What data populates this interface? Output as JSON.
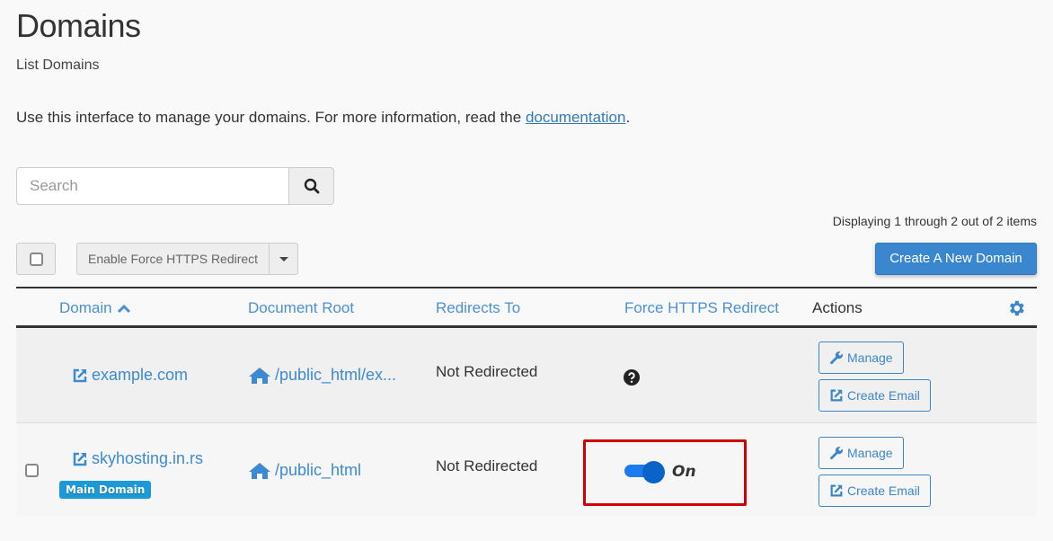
{
  "header": {
    "title": "Domains",
    "subtitle": "List Domains",
    "intro_text": "Use this interface to manage your domains. For more information, read the ",
    "intro_link": "documentation",
    "intro_suffix": "."
  },
  "search": {
    "placeholder": "Search",
    "value": "",
    "icon": "search-icon"
  },
  "toolbar": {
    "display_count": "Displaying 1 through 2 out of 2 items",
    "bulk_action_label": "Enable Force HTTPS Redirect",
    "create_button_label": "Create A New Domain"
  },
  "table": {
    "columns": [
      {
        "label": "Domain",
        "sort": "ascending"
      },
      {
        "label": "Document Root"
      },
      {
        "label": "Redirects To"
      },
      {
        "label": "Force HTTPS Redirect"
      },
      {
        "label": "Actions"
      }
    ],
    "settings_icon": "gear-icon",
    "rows": [
      {
        "domain": "example.com",
        "document_root": "/public_html/ex...",
        "redirects_to": "Not Redirected",
        "force_https": "help",
        "actions": [
          "Manage",
          "Create Email"
        ]
      },
      {
        "domain": "skyhosting.in.rs",
        "badge": "Main Domain",
        "document_root": "/public_html",
        "redirects_to": "Not Redirected",
        "force_https": "on",
        "force_https_label": "On",
        "actions": [
          "Manage",
          "Create Email"
        ]
      }
    ]
  },
  "colors": {
    "link": "#3d8ad1",
    "primary_button": "#3a87cf",
    "badge": "#1b9ad6",
    "toggle_on": "#1a7cf0",
    "highlight": "#d00000"
  }
}
